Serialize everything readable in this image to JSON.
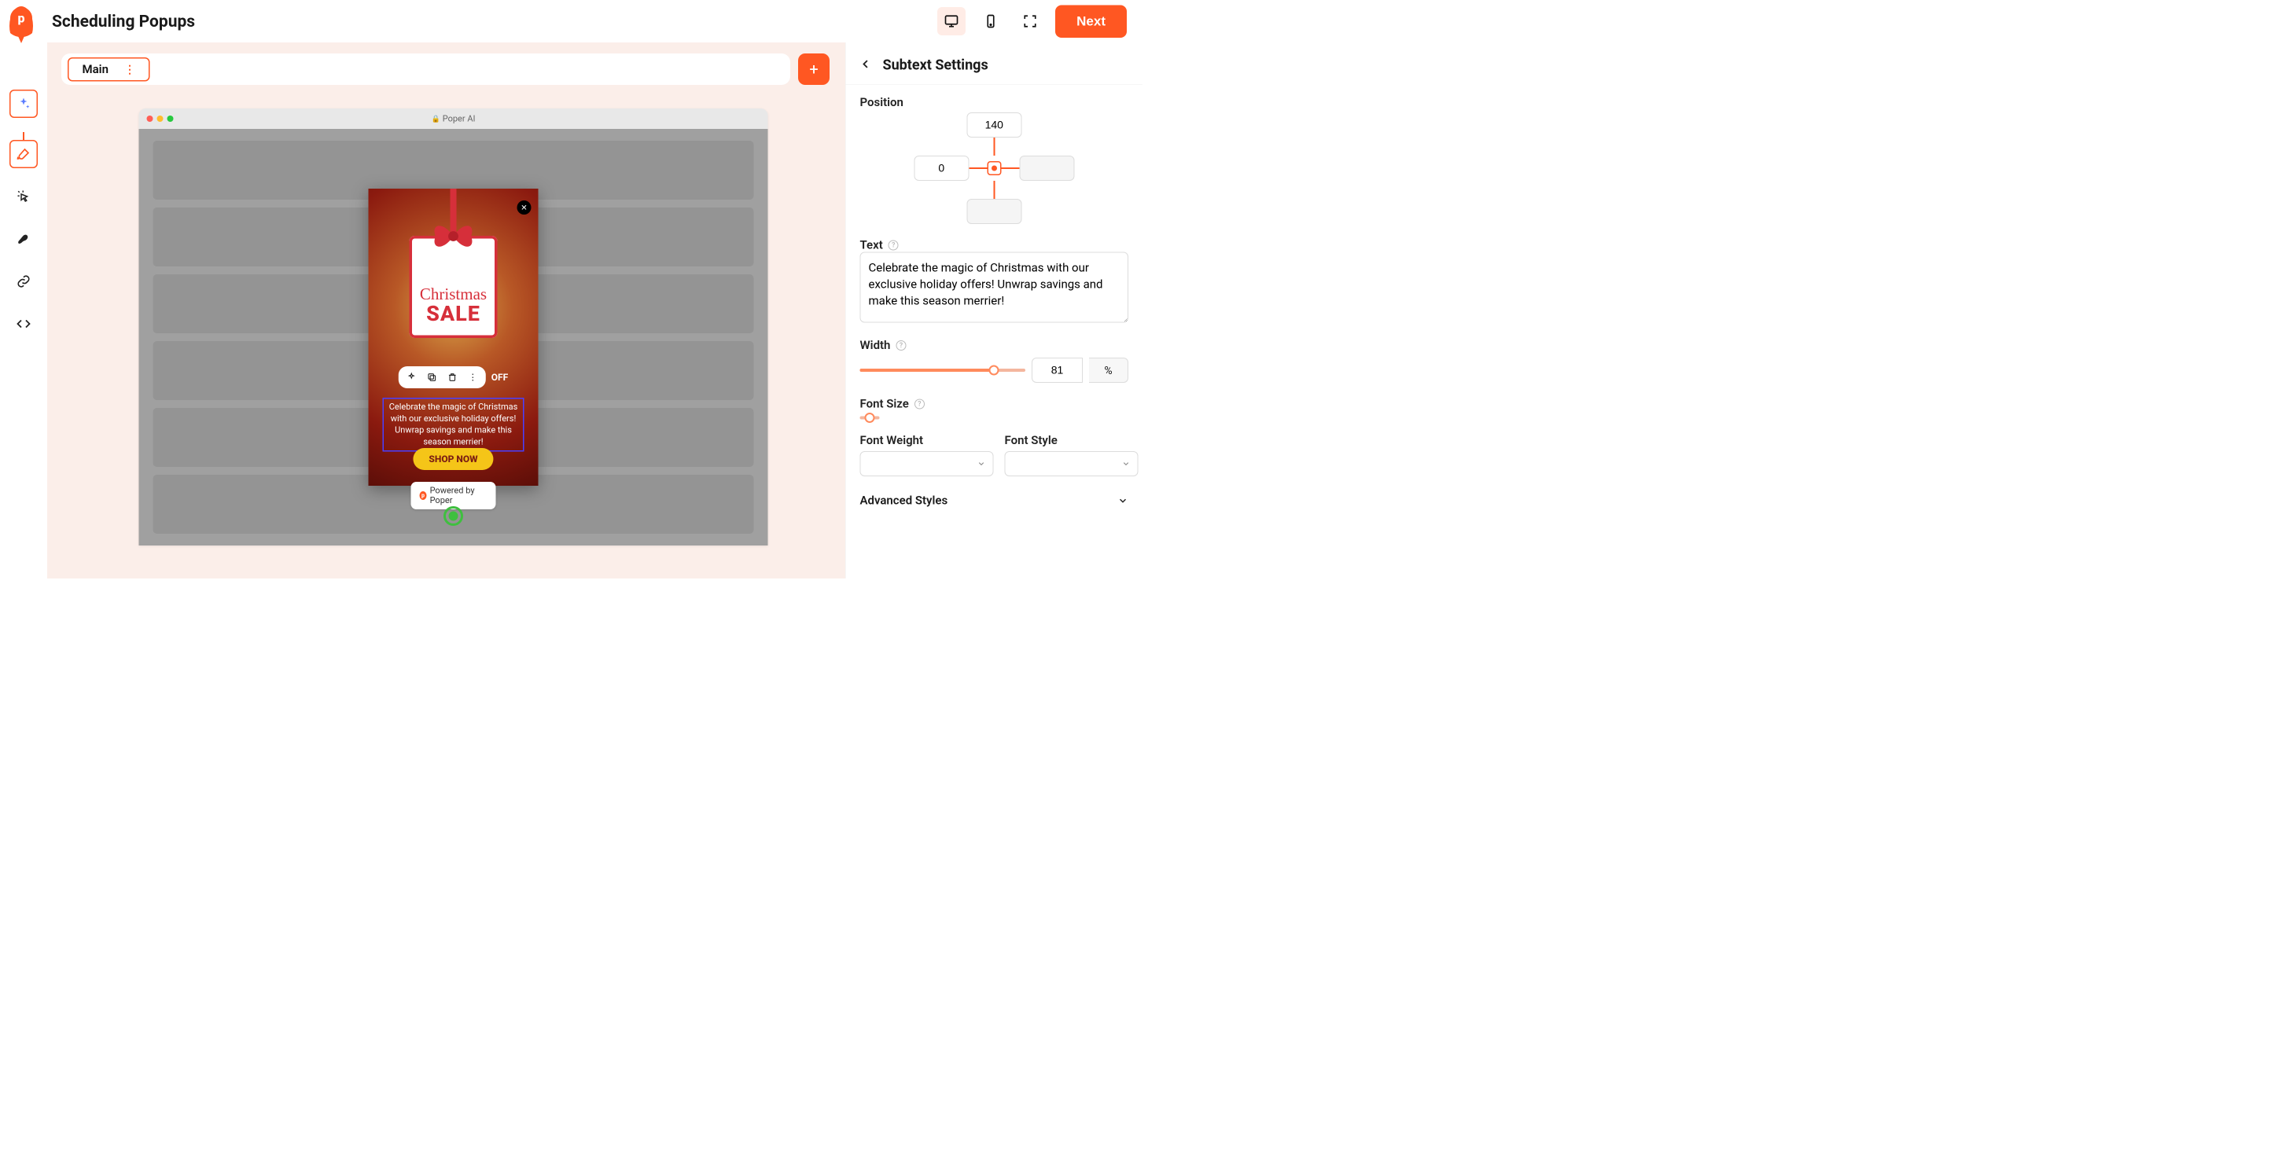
{
  "colors": {
    "accent": "#ff5722",
    "rail_accent": "#ff5722"
  },
  "header": {
    "page_title": "Scheduling Popups",
    "next_label": "Next"
  },
  "main": {
    "tab_label": "Main",
    "browser_title": "Poper AI",
    "popup": {
      "tag_script": "Christmas",
      "tag_sale": "SALE",
      "off_label": "OFF",
      "subtext": "Celebrate the magic of Christmas with our exclusive holiday offers! Unwrap savings and make this season merrier!",
      "shop_label": "SHOP NOW",
      "powered": "Powered by Poper"
    }
  },
  "panel": {
    "title": "Subtext Settings",
    "sections": {
      "position": {
        "label": "Position",
        "top": "140",
        "left": "0"
      },
      "text": {
        "label": "Text",
        "value": "Celebrate the magic of Christmas with our exclusive holiday offers! Unwrap savings and make this season merrier!"
      },
      "width": {
        "label": "Width",
        "value": "81",
        "unit": "%"
      },
      "font_size": {
        "label": "Font Size"
      },
      "font_weight": {
        "label": "Font Weight",
        "value": ""
      },
      "font_style": {
        "label": "Font Style",
        "value": ""
      },
      "advanced": {
        "label": "Advanced Styles"
      }
    }
  }
}
